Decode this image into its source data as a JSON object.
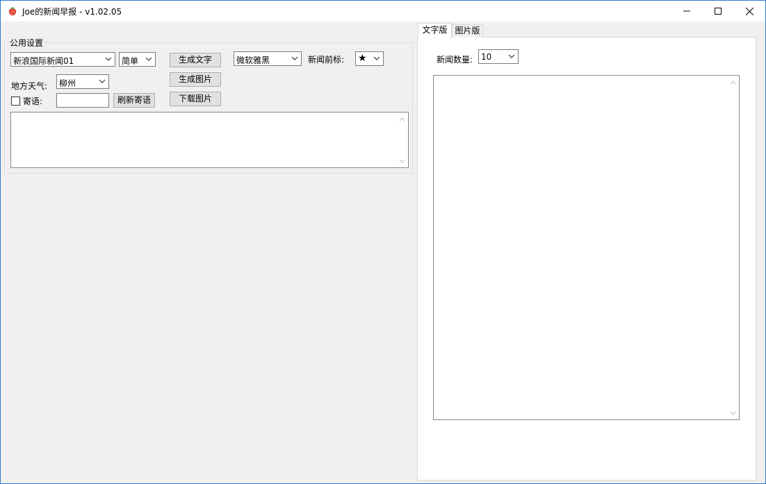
{
  "window": {
    "title": "Joe的新闻早报 - v1.02.05",
    "controls": {
      "minimize_icon": "minimize-icon",
      "maximize_icon": "maximize-icon",
      "close_icon": "close-icon"
    }
  },
  "left_panel": {
    "group_title": "公用设置",
    "news_source": {
      "value": "新浪国际新闻01"
    },
    "script_variant": {
      "value": "简单"
    },
    "weather_label": "地方天气:",
    "weather_city": {
      "value": "柳州"
    },
    "message_checkbox": {
      "label": "寄语:",
      "checked": false
    },
    "message_input": {
      "value": ""
    },
    "refresh_message_button": "刷新寄语",
    "generate_text_button": "生成文字",
    "generate_image_button": "生成图片",
    "download_image_button": "下载图片",
    "font_select": {
      "value": "微软雅黑"
    },
    "news_prefix_label": "新闻前标:",
    "news_prefix_select": {
      "value": "★"
    },
    "log_textarea": {
      "value": ""
    }
  },
  "right_panel": {
    "tabs": [
      {
        "label": "文字版",
        "active": true
      },
      {
        "label": "图片版",
        "active": false
      }
    ],
    "news_count_label": "新闻数量:",
    "news_count_select": {
      "value": "10"
    },
    "output_textarea": {
      "value": ""
    }
  },
  "colors": {
    "window_border": "#2b79d0",
    "background": "#f0f0f0",
    "button_face": "#e1e1e1"
  }
}
